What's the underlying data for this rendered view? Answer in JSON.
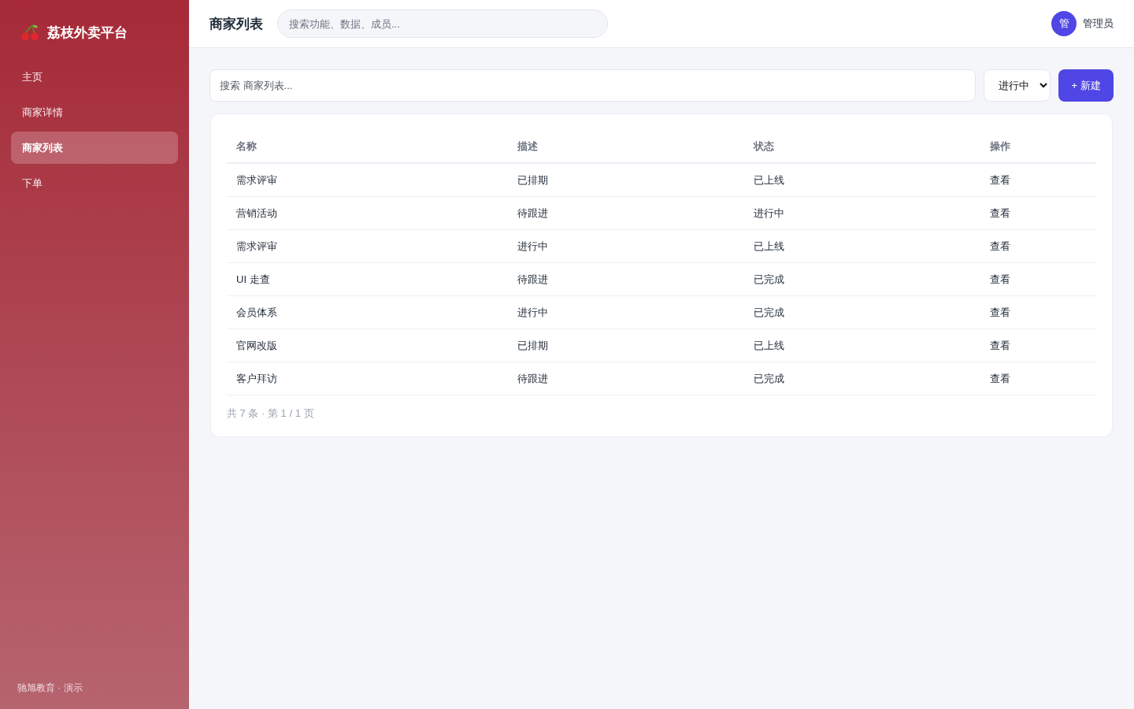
{
  "sidebar": {
    "brand": "荔枝外卖平台",
    "items": [
      {
        "label": "主页",
        "selected": false
      },
      {
        "label": "商家详情",
        "selected": false
      },
      {
        "label": "商家列表",
        "selected": true
      },
      {
        "label": "下单",
        "selected": false
      }
    ],
    "footer": "驰旭教育 · 演示"
  },
  "header": {
    "title": "商家列表",
    "search": {
      "placeholder": "搜索功能、数据、成员..."
    },
    "user": {
      "avatar_text": "管",
      "name": "管理员"
    }
  },
  "toolbar": {
    "search": {
      "placeholder": "搜索 商家列表..."
    },
    "filter": {
      "value": "进行中"
    },
    "new_button": "+ 新建"
  },
  "table": {
    "columns": [
      "名称",
      "描述",
      "状态",
      "操作"
    ],
    "rows": [
      {
        "name": "需求评审",
        "description": "已排期",
        "status": "已上线",
        "action": "查看"
      },
      {
        "name": "营销活动",
        "description": "待跟进",
        "status": "进行中",
        "action": "查看"
      },
      {
        "name": "需求评审",
        "description": "进行中",
        "status": "已上线",
        "action": "查看"
      },
      {
        "name": "UI 走查",
        "description": "待跟进",
        "status": "已完成",
        "action": "查看"
      },
      {
        "name": "会员体系",
        "description": "进行中",
        "status": "已完成",
        "action": "查看"
      },
      {
        "name": "官网改版",
        "description": "已排期",
        "status": "已上线",
        "action": "查看"
      },
      {
        "name": "客户拜访",
        "description": "待跟进",
        "status": "已完成",
        "action": "查看"
      }
    ],
    "pagination": "共 7 条 · 第 1 / 1 页"
  }
}
